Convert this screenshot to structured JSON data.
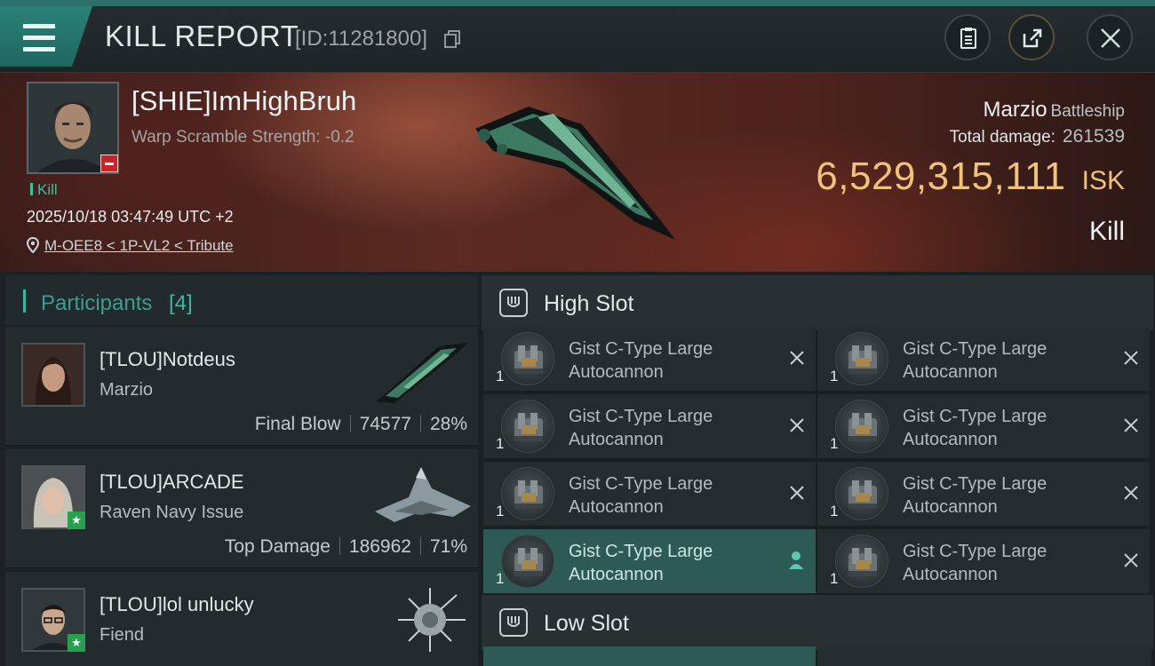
{
  "header": {
    "title": "KILL REPORT",
    "report_id": "[ID:11281800]",
    "icons": [
      "menu-icon",
      "copy-icon",
      "clipboard-icon",
      "share-icon",
      "close-icon"
    ]
  },
  "victim": {
    "name": "[SHIE]ImHighBruh",
    "subtitle": "Warp Scramble Strength: -0.2",
    "tag": "Kill",
    "time": "2025/10/18 03:47:49 UTC +2",
    "location": "M-OEE8 < 1P-VL2 < Tribute",
    "ship_name": "Marzio",
    "ship_class": "Battleship",
    "total_damage_label": "Total damage:",
    "total_damage": "261539",
    "isk_value": "6,529,315,111",
    "isk_unit": "ISK",
    "result": "Kill"
  },
  "participants": {
    "title": "Participants",
    "count": "[4]",
    "items": [
      {
        "name": "[TLOU]Notdeus",
        "ship": "Marzio",
        "role": "Final Blow",
        "damage": "74577",
        "percent": "28%"
      },
      {
        "name": "[TLOU]ARCADE",
        "ship": "Raven Navy Issue",
        "role": "Top Damage",
        "damage": "186962",
        "percent": "71%"
      },
      {
        "name": "[TLOU]lol unlucky",
        "ship": "Fiend"
      }
    ]
  },
  "slots": {
    "high_title": "High Slot",
    "low_title": "Low Slot",
    "high_items": [
      {
        "line1": "Gist C-Type Large",
        "line2": "Autocannon",
        "qty": "1",
        "status": "destroyed"
      },
      {
        "line1": "Gist C-Type Large",
        "line2": "Autocannon",
        "qty": "1",
        "status": "destroyed"
      },
      {
        "line1": "Gist C-Type Large",
        "line2": "Autocannon",
        "qty": "1",
        "status": "destroyed"
      },
      {
        "line1": "Gist C-Type Large",
        "line2": "Autocannon",
        "qty": "1",
        "status": "dropped"
      },
      {
        "line1": "Gist C-Type Large",
        "line2": "Autocannon",
        "qty": "1",
        "status": "destroyed"
      },
      {
        "line1": "Gist C-Type Large",
        "line2": "Autocannon",
        "qty": "1",
        "status": "destroyed"
      },
      {
        "line1": "Gist C-Type Large",
        "line2": "Autocannon",
        "qty": "1",
        "status": "destroyed"
      },
      {
        "line1": "Gist C-Type Large",
        "line2": "Autocannon",
        "qty": "1",
        "status": "destroyed"
      }
    ]
  },
  "colors": {
    "accent": "#3fb6a2",
    "isk": "#f0c27a",
    "active_row": "#2e5a55",
    "kill_badge": "#c8252a"
  }
}
